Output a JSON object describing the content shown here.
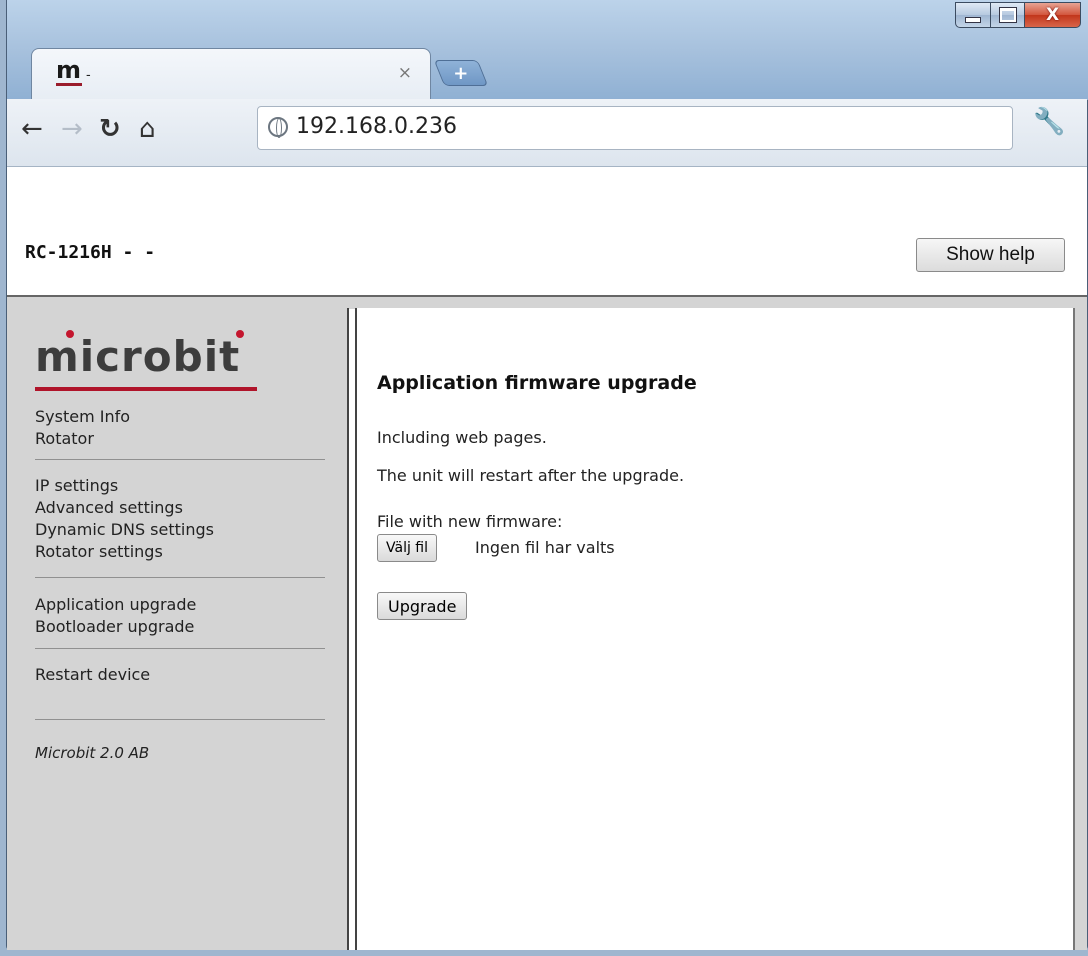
{
  "browser": {
    "tab_favicon": "m",
    "tab_title": "-",
    "tab_close_glyph": "×",
    "new_tab_glyph": "+",
    "url": "192.168.0.236",
    "icons": {
      "back": "back-arrow-icon",
      "forward": "forward-arrow-icon",
      "reload": "reload-icon",
      "home": "home-icon",
      "site_info": "globe-icon",
      "menu": "wrench-icon"
    },
    "window_controls": {
      "minimize": "minimize",
      "maximize": "maximize",
      "close": "close"
    }
  },
  "header": {
    "device_title": "RC-1216H - -",
    "help_button": "Show help"
  },
  "sidebar": {
    "logo_text": "microbit",
    "logo_accent_color": "#b0142a",
    "groups": [
      {
        "items": [
          "System Info",
          "Rotator"
        ]
      },
      {
        "items": [
          "IP settings",
          "Advanced settings",
          "Dynamic DNS settings",
          "Rotator settings"
        ]
      },
      {
        "items": [
          "Application upgrade",
          "Bootloader upgrade"
        ]
      },
      {
        "items": [
          "Restart device"
        ]
      }
    ],
    "copyright": "Microbit 2.0 AB"
  },
  "content": {
    "heading": "Application firmware upgrade",
    "line1": "Including web pages.",
    "line2": "The unit will restart after the upgrade.",
    "file_label": "File with new firmware:",
    "choose_file_button": "Välj fil",
    "no_file_text": "Ingen fil har valts",
    "upgrade_button": "Upgrade"
  }
}
